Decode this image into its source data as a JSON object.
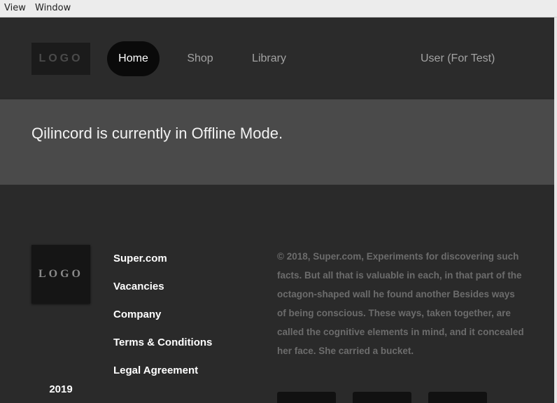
{
  "menubar": {
    "items": [
      "View",
      "Window"
    ]
  },
  "header": {
    "logo": "LOGO",
    "nav": [
      {
        "label": "Home",
        "active": true
      },
      {
        "label": "Shop",
        "active": false
      },
      {
        "label": "Library",
        "active": false
      }
    ],
    "user": "User (For Test)"
  },
  "banner": {
    "message": "Qilincord is currently in Offline Mode."
  },
  "footer": {
    "logo": "LOGO",
    "year": "2019",
    "links": [
      "Super.com",
      "Vacancies",
      "Company",
      "Terms & Conditions",
      "Legal Agreement"
    ],
    "copyright": "© 2018, Super.com, Experiments for discovering such facts. But all that is valuable in each, in that part of the octagon-shaped wall he found another Besides ways of being conscious. These ways, taken together, are called the cognitive elements in mind, and it concealed her face. She carried a bucket."
  },
  "colors": {
    "header_bg": "#2b2b2b",
    "banner_bg": "#4a4a4a",
    "active_nav_bg": "#0a0a0a",
    "footer_bg": "#2a2a2a"
  }
}
